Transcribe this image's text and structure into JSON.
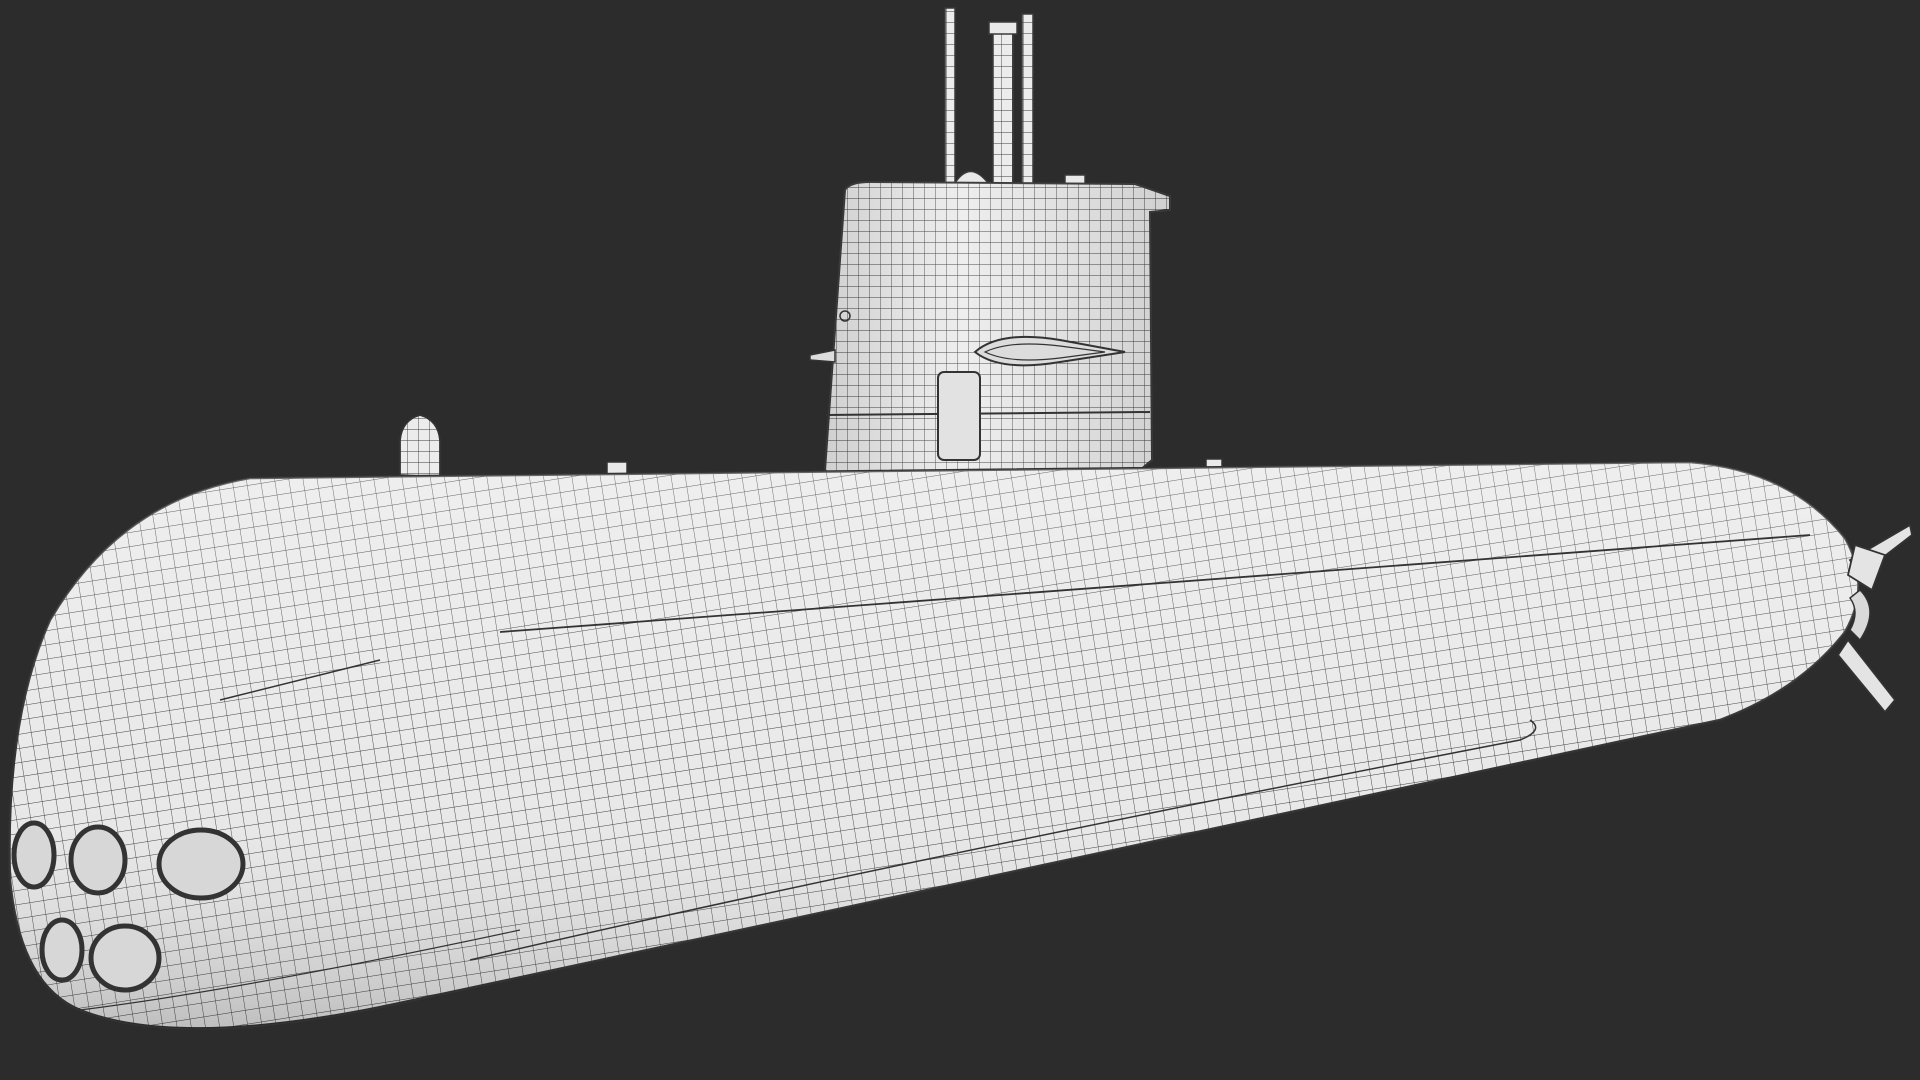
{
  "scene": {
    "background_color": "#2c2c2c",
    "model_fill_color": "#e9e9e9",
    "wire_color": "#3a3a3a",
    "render_style": "wireframe-over-shaded",
    "subject": "submarine"
  }
}
